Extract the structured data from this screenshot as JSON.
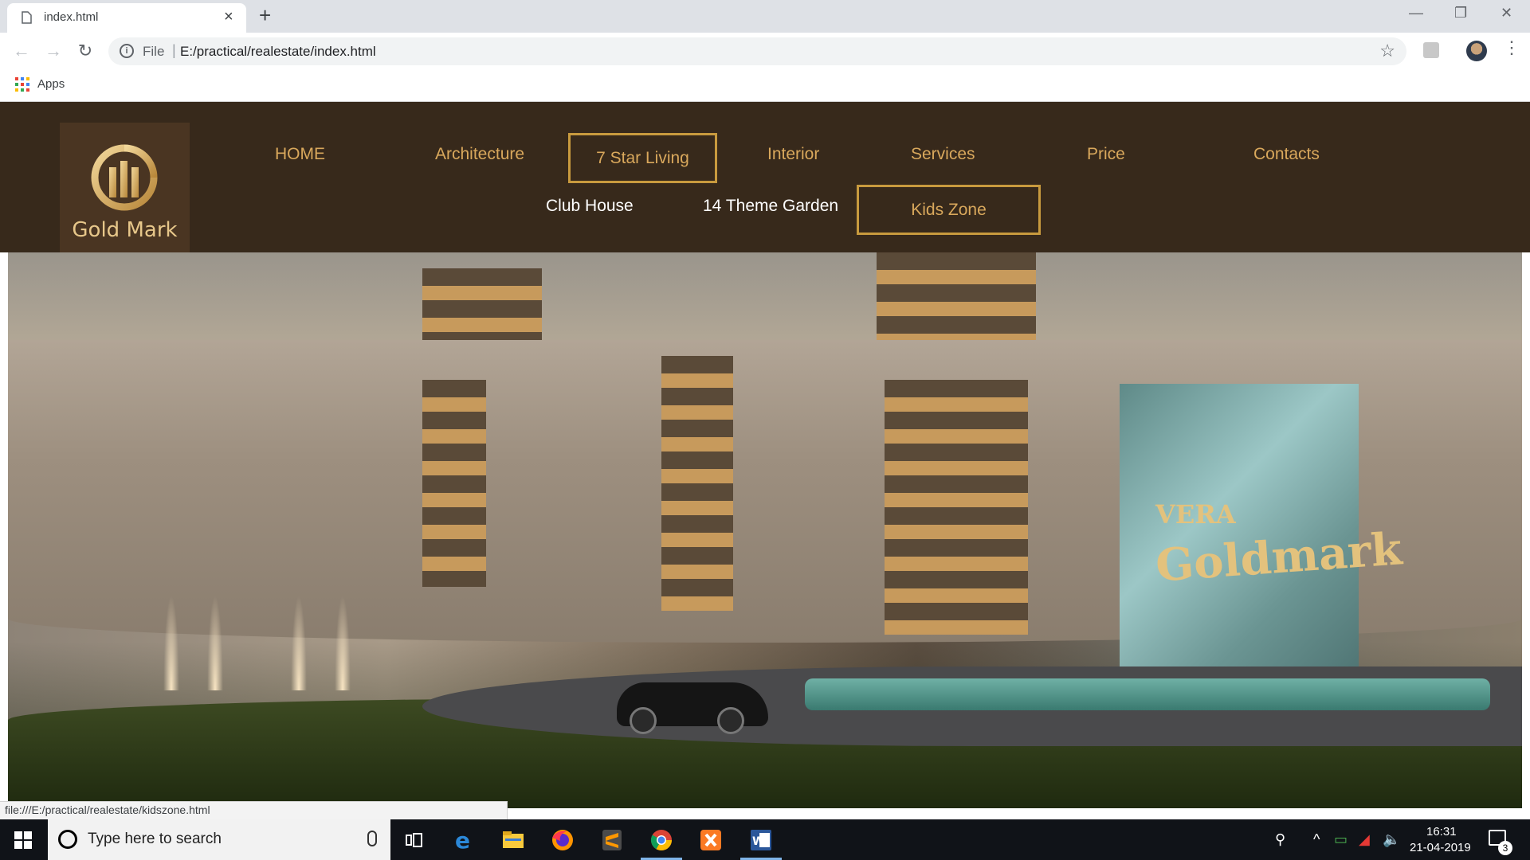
{
  "browser": {
    "tab_title": "index.html",
    "tab_close": "×",
    "new_tab": "+",
    "window_controls": {
      "minimize": "—",
      "restore": "❐",
      "close": "✕"
    },
    "nav": {
      "back": "←",
      "forward": "→",
      "reload": "↻"
    },
    "address": {
      "scheme": "File",
      "separator": "|",
      "url": "E:/practical/realestate/index.html",
      "info_icon": "i",
      "star": "☆"
    },
    "menu": "⋮",
    "bookmarks": {
      "apps_label": "Apps"
    },
    "status_url": "file:///E:/practical/realestate/kidszone.html"
  },
  "site": {
    "logo_text": "Gold Mark",
    "nav_row1": [
      {
        "label": "HOME"
      },
      {
        "label": "Architecture"
      },
      {
        "label": "7 Star Living"
      },
      {
        "label": "Interior"
      },
      {
        "label": "Services"
      },
      {
        "label": "Price"
      },
      {
        "label": "Contacts"
      }
    ],
    "nav_row2": [
      {
        "label": "Club House"
      },
      {
        "label": "14 Theme Garden"
      },
      {
        "label": "Kids Zone"
      }
    ],
    "hero": {
      "brand_small": "VERA",
      "brand_big": "Goldmark"
    },
    "colors": {
      "header_bg": "#37291b",
      "accent": "#d9a85c",
      "border": "#c89a3e"
    }
  },
  "taskbar": {
    "search_placeholder": "Type here to search",
    "time": "16:31",
    "date": "21-04-2019",
    "notifications": "3",
    "apps": [
      "task-view-icon",
      "edge-icon",
      "file-explorer-icon",
      "firefox-icon",
      "sublime-icon",
      "chrome-icon",
      "xampp-icon",
      "word-icon"
    ]
  }
}
